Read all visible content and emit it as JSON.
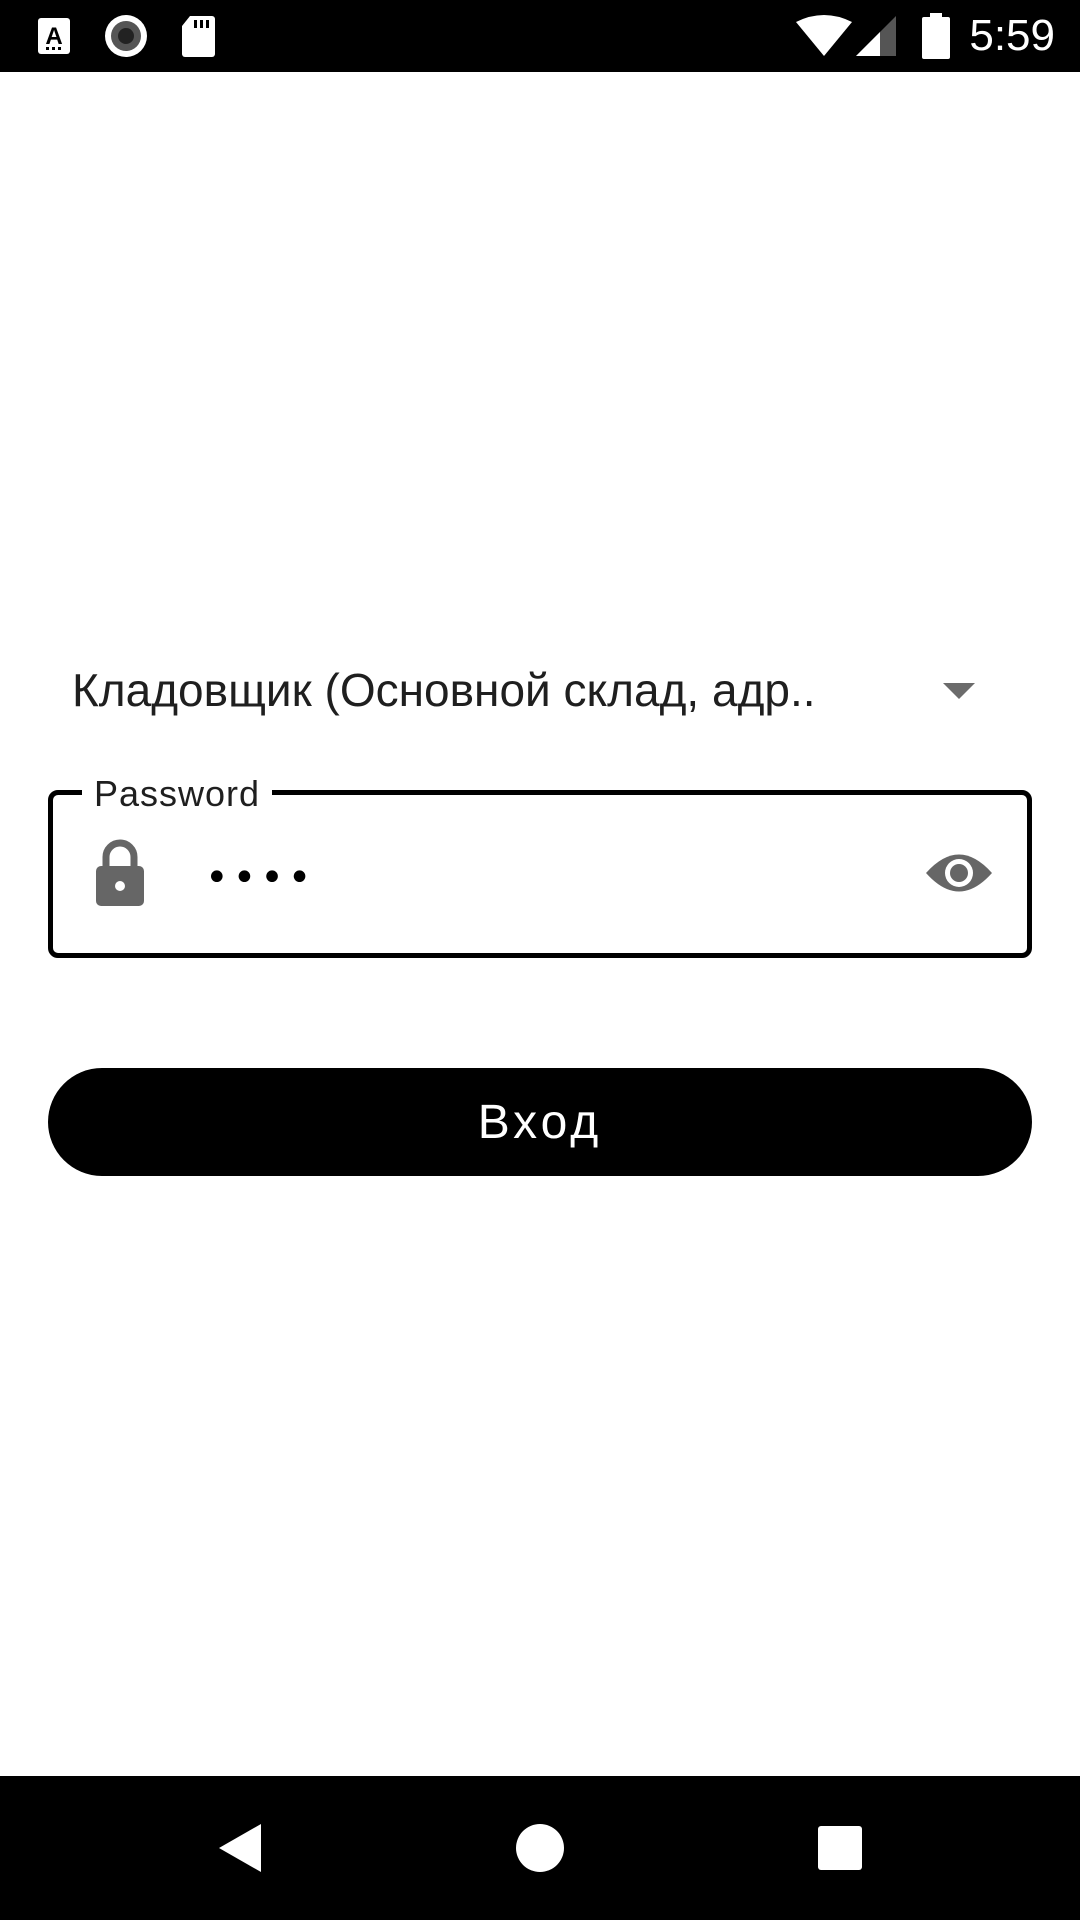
{
  "status_bar": {
    "time": "5:59",
    "icons": [
      "font-notification-icon",
      "record-icon",
      "sd-card-icon",
      "wifi-icon",
      "cellular-signal-icon",
      "battery-icon"
    ]
  },
  "login": {
    "role_selected": "Кладовщик (Основной склад, адр..",
    "password_label": "Password",
    "password_value": "••••",
    "login_button": "Вход"
  },
  "nav_bar": {
    "icons": [
      "back-icon",
      "home-icon",
      "recents-icon"
    ]
  }
}
